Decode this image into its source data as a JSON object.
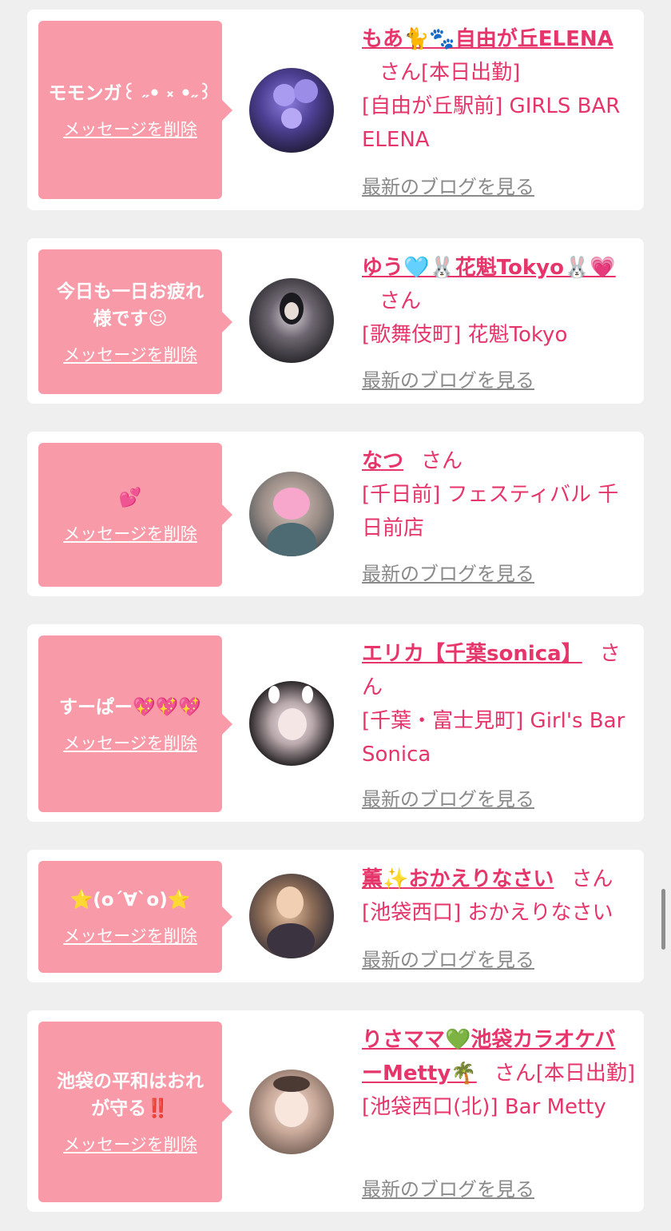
{
  "delete_label": "メッセージを削除",
  "blog_label": "最新のブログを見る",
  "san_label": "さん",
  "colors": {
    "accent": "#e5356a",
    "bubble": "#f99aa8",
    "muted": "#8a8a8a"
  },
  "cards": [
    {
      "message": "モモンガ꒰ ˶• ༝ •˶꒱",
      "name": "もあ🐈🐾自由が丘ELENA",
      "suffix": "[本日出勤]",
      "location": "[自由が丘駅前] GIRLS BAR ELENA"
    },
    {
      "message": "今日も一日お疲れ様です😉",
      "name": "ゆう🩵🐰花魁Tokyo🐰💗",
      "suffix": "",
      "location": "[歌舞伎町] 花魁Tokyo"
    },
    {
      "message": "💕",
      "name": "なつ",
      "suffix": "",
      "location": "[千日前] フェスティバル 千日前店"
    },
    {
      "message": "すーぱー💖💖💖",
      "name": "エリカ【千葉sonica】",
      "suffix": "",
      "location": "[千葉・富士見町] Girl's Bar Sonica"
    },
    {
      "message": "⭐(o´∀`o)⭐",
      "name": "薫✨おかえりなさい",
      "suffix": "",
      "location": "[池袋西口] おかえりなさい"
    },
    {
      "message": "池袋の平和はおれが守る‼️",
      "name": "りさママ💚池袋カラオケバーMetty🌴",
      "suffix": "[本日出勤]",
      "location": "[池袋西口(北)] Bar Metty"
    }
  ]
}
